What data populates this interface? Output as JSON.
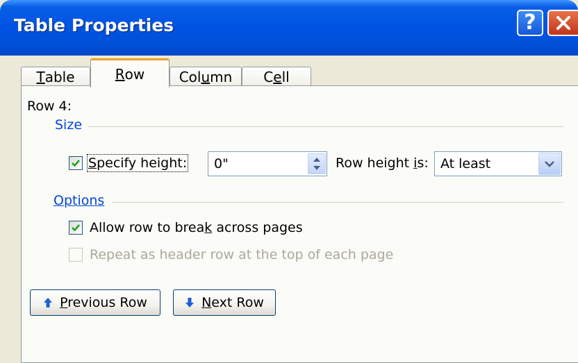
{
  "window": {
    "title": "Table Properties"
  },
  "tabs": [
    {
      "label": "Table",
      "mnemonic": "T",
      "rest": "able"
    },
    {
      "label": "Row",
      "mnemonic": "R",
      "rest": "ow"
    },
    {
      "label": "Column",
      "pre": "Col",
      "mnemonic": "u",
      "rest": "mn"
    },
    {
      "label": "Cell",
      "pre": "C",
      "mnemonic": "e",
      "rest": "ll"
    }
  ],
  "active_tab": "Row",
  "row_label": "Row 4:",
  "size": {
    "title": "Size",
    "specify_height": {
      "label": "Specify height:",
      "mnemonic": "S",
      "rest": "pecify height:",
      "checked": true
    },
    "height_value": "0\"",
    "row_height_is": {
      "pre": "Row height ",
      "mnemonic": "i",
      "rest": "s:"
    },
    "row_height_mode": "At least"
  },
  "options": {
    "title": "Options",
    "allow_break": {
      "pre": "Allow row to brea",
      "mnemonic": "k",
      "rest": " across pages",
      "checked": true
    },
    "repeat_header": {
      "label": "Repeat as header row at the top of each page",
      "checked": false,
      "disabled": true
    }
  },
  "buttons": {
    "previous_row": {
      "mnemonic": "P",
      "rest": "revious Row"
    },
    "next_row": {
      "mnemonic": "N",
      "rest": "ext Row"
    }
  },
  "colors": {
    "group_title": "#0046d5",
    "check": "#21a121",
    "arrow": "#1d5fd6"
  }
}
